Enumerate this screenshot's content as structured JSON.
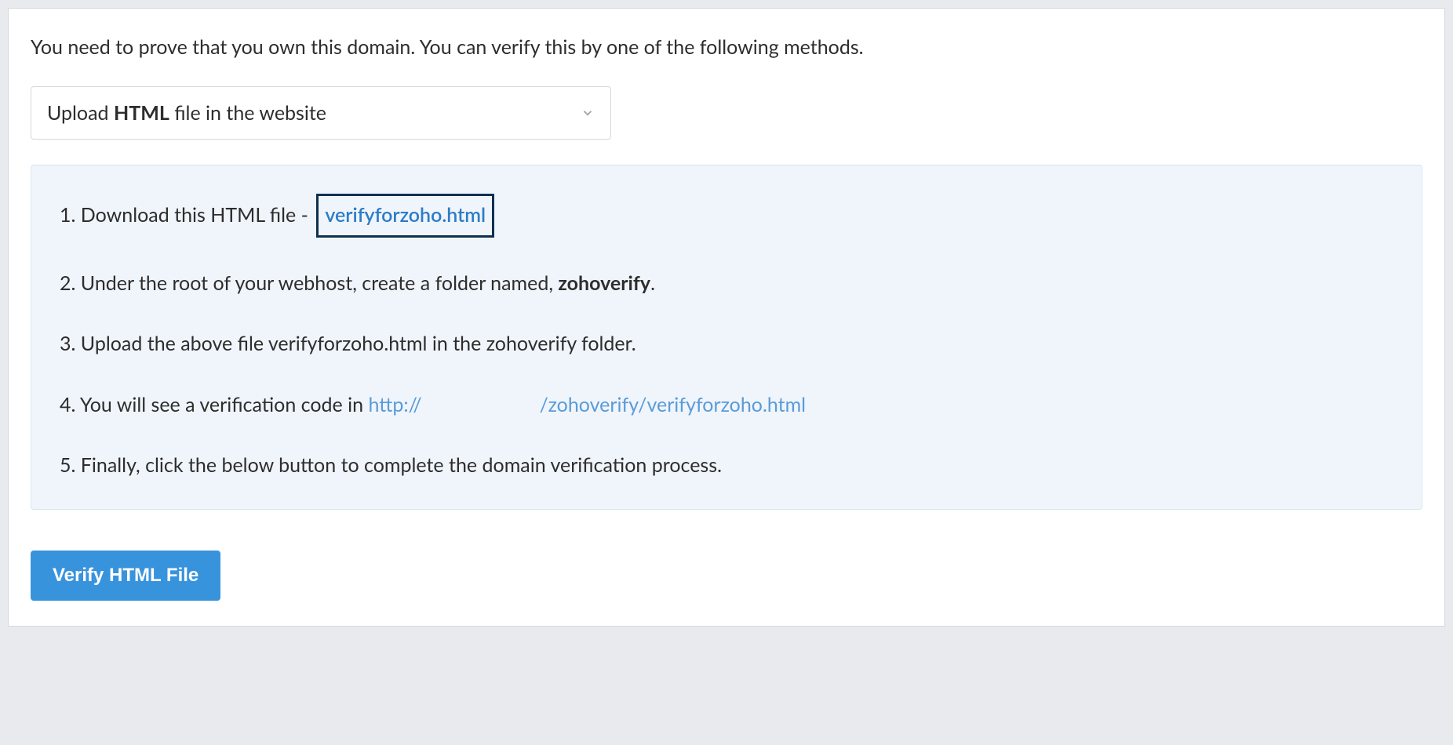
{
  "intro": "You need to prove that you own this domain. You can verify this by one of the following methods.",
  "dropdown": {
    "prefix": "Upload ",
    "bold": "HTML",
    "suffix": " file in the website"
  },
  "steps": {
    "s1_prefix": "1. Download this HTML file - ",
    "s1_link": "verifyforzoho.html",
    "s2_prefix": "2. Under the root of your webhost, create a folder named, ",
    "s2_bold": "zohoverify",
    "s2_suffix": ".",
    "s3": "3. Upload the above file verifyforzoho.html in the zohoverify folder.",
    "s4_prefix": "4. You will see a verification code in ",
    "s4_url_prefix": "http://",
    "s4_url_suffix": "/zohoverify/verifyforzoho.html",
    "s5": "5. Finally, click the below button to complete the domain verification process."
  },
  "button": {
    "verify": "Verify HTML File"
  }
}
